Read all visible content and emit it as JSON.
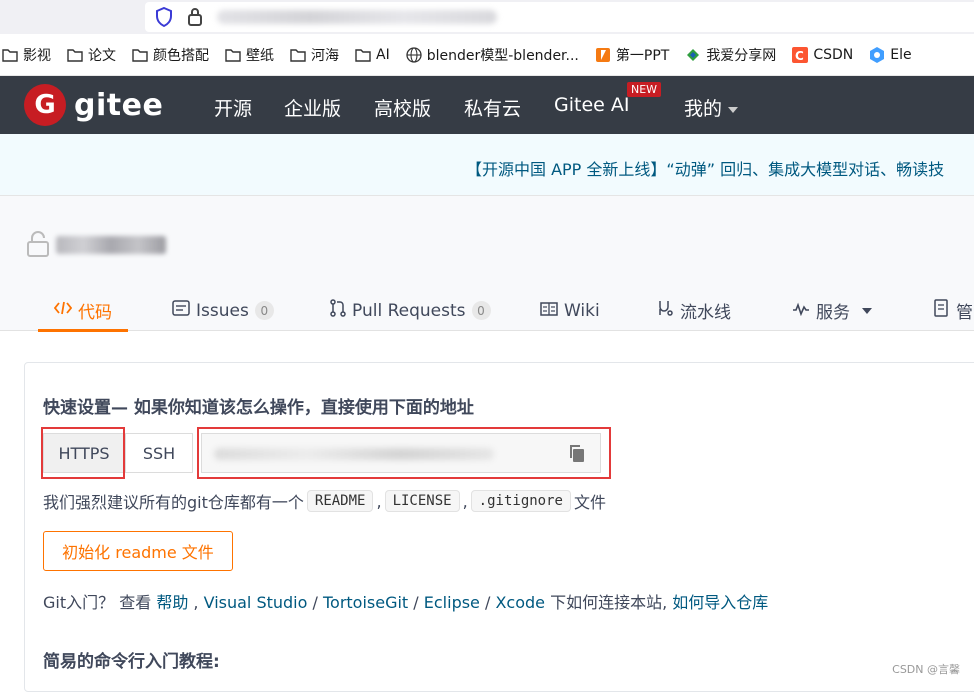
{
  "bookmarks": [
    {
      "label": "影视",
      "icon": "folder-icon"
    },
    {
      "label": "论文",
      "icon": "folder-icon"
    },
    {
      "label": "颜色搭配",
      "icon": "folder-icon"
    },
    {
      "label": "壁纸",
      "icon": "folder-icon"
    },
    {
      "label": "河海",
      "icon": "folder-icon"
    },
    {
      "label": "AI",
      "icon": "folder-icon"
    },
    {
      "label": "blender模型-blender...",
      "icon": "globe-icon"
    },
    {
      "label": "第一PPT",
      "icon": "ppt-icon"
    },
    {
      "label": "我爱分享网",
      "icon": "share-icon"
    },
    {
      "label": "CSDN",
      "icon": "csdn-icon"
    },
    {
      "label": "Ele",
      "icon": "element-icon"
    }
  ],
  "nav": {
    "logo_letter": "G",
    "logo_text": "gitee",
    "items": [
      "开源",
      "企业版",
      "高校版",
      "私有云",
      "Gitee AI",
      "我的"
    ],
    "new_badge": "NEW"
  },
  "announcement": "【开源中国 APP 全新上线】“动弹” 回归、集成大模型对话、畅读技",
  "tabs": [
    {
      "label": "代码",
      "icon": "code-icon",
      "active": true
    },
    {
      "label": "Issues",
      "icon": "issues-icon",
      "count": "0"
    },
    {
      "label": "Pull Requests",
      "icon": "pull-request-icon",
      "count": "0"
    },
    {
      "label": "Wiki",
      "icon": "wiki-icon"
    },
    {
      "label": "流水线",
      "icon": "pipeline-icon"
    },
    {
      "label": "服务",
      "icon": "service-icon"
    },
    {
      "label": "管",
      "icon": "manage-icon"
    }
  ],
  "quick_setup": {
    "title": "快速设置— 如果你知道该怎么操作，直接使用下面的地址",
    "https_label": "HTTPS",
    "ssh_label": "SSH",
    "recommend_prefix": "我们强烈建议所有的git仓库都有一个",
    "readme": "README",
    "license": "LICENSE",
    "gitignore": ".gitignore",
    "recommend_suffix": "文件",
    "init_button": "初始化 readme 文件",
    "git_intro": "Git入门？ 查看",
    "help_link": "帮助",
    "vs_link": "Visual Studio",
    "tortoise_link": "TortoiseGit",
    "eclipse_link": "Eclipse",
    "xcode_link": "Xcode",
    "connect_text": "下如何连接本站,",
    "import_link": "如何导入仓库",
    "cli_title": "简易的命令行入门教程:"
  },
  "watermark": "CSDN @言馨",
  "colors": {
    "nav_bg": "#363c45",
    "brand_red": "#c71d23",
    "accent_orange": "#fe7300",
    "link_blue": "#005980",
    "highlight_red": "#e33a3a"
  }
}
